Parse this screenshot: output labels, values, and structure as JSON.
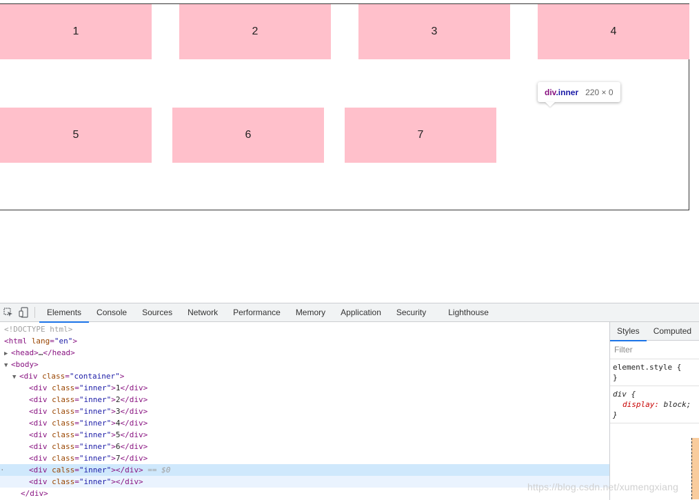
{
  "demo": {
    "boxes": [
      "1",
      "2",
      "3",
      "4",
      "5",
      "6",
      "7"
    ],
    "box_color": "#ffc0cb",
    "tooltip": {
      "tag": "div",
      "cls": ".inner",
      "size": "220 × 0"
    }
  },
  "devtools": {
    "icons": [
      "inspect-element-icon",
      "device-toolbar-icon"
    ],
    "tabs": [
      "Elements",
      "Console",
      "Sources",
      "Network",
      "Performance",
      "Memory",
      "Application",
      "Security",
      "Lighthouse"
    ],
    "active_tab": "Elements",
    "dom": {
      "doctype": "<!DOCTYPE html>",
      "html_open": "<html",
      "lang_attr": " lang",
      "lang_val": "\"en\"",
      "head_open": "<head>",
      "ellipsis": "…",
      "head_close": "</head>",
      "body_open": "<body>",
      "div_open": "<div",
      "class_attr": " class",
      "calss_attr": " calss",
      "container_val": "\"container\"",
      "inner_val": "\"inner\"",
      "gt": ">",
      "div_close": "</div>",
      "eq_dollar": " == $0",
      "inner_texts": [
        "1",
        "2",
        "3",
        "4",
        "5",
        "6",
        "7"
      ],
      "eq": "=",
      "html_gt": ">",
      "selected_marker": "·"
    },
    "styles": {
      "tabs": [
        "Styles",
        "Computed"
      ],
      "filter_placeholder": "Filter",
      "element_style": "element.style {",
      "close_brace": "}",
      "div_rule": "div {",
      "prop": "display",
      "value": "block;"
    }
  },
  "watermark": "https://blog.csdn.net/xumengxiang"
}
